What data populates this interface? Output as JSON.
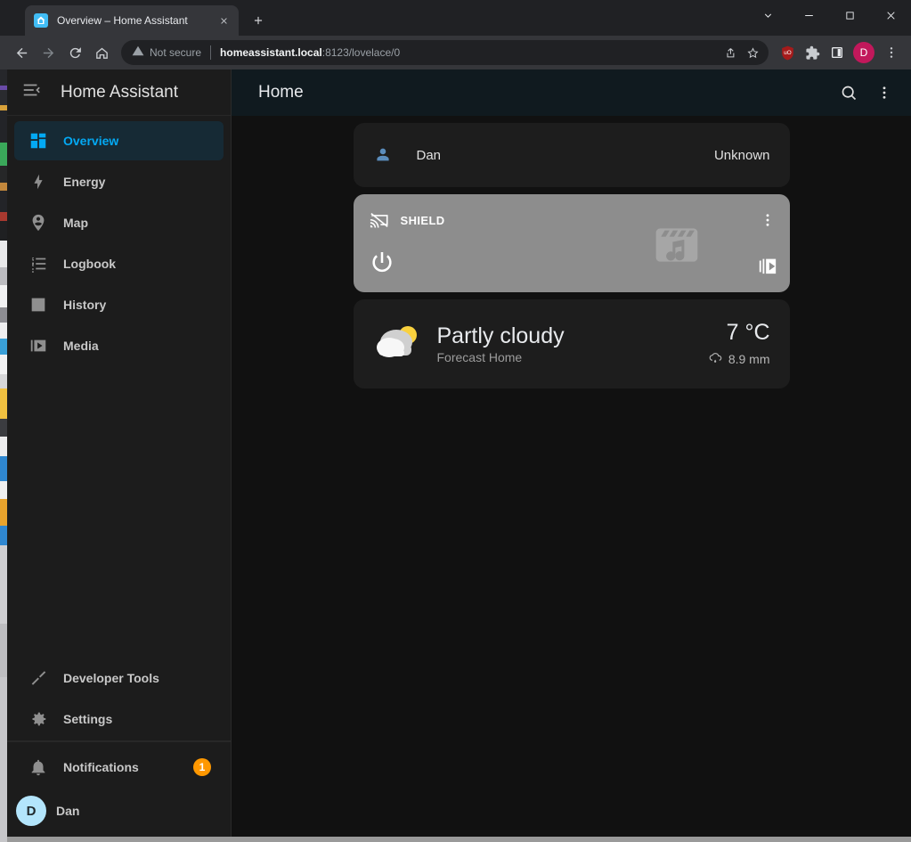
{
  "browser": {
    "tab": {
      "title": "Overview – Home Assistant",
      "favicon": "home-assistant-logo-icon",
      "close_icon": "close-icon"
    },
    "new_tab_label": "+",
    "window_controls": [
      "tab-search-chevron-icon",
      "minimize-icon",
      "maximize-icon",
      "close-icon"
    ],
    "toolbar": {
      "back_icon": "back-arrow-icon",
      "forward_icon": "forward-arrow-icon",
      "reload_icon": "reload-icon",
      "home_icon": "home-icon",
      "security_label": "Not secure",
      "security_icon": "warning-triangle-icon",
      "url_host": "homeassistant.local",
      "url_path": ":8123/lovelace/0",
      "share_icon": "share-icon",
      "bookmark_icon": "star-icon",
      "ublock_icon": "ublock-origin-shield-icon",
      "ublock_label": "uO",
      "extensions_icon": "puzzle-piece-icon",
      "sidepanel_icon": "side-panel-icon",
      "profile_initial": "D",
      "menu_icon": "kebab-menu-icon"
    }
  },
  "sidebar": {
    "menu_icon": "collapse-menu-icon",
    "title": "Home Assistant",
    "items": [
      {
        "label": "Overview",
        "icon": "view-dashboard-icon",
        "active": true
      },
      {
        "label": "Energy",
        "icon": "lightning-bolt-icon",
        "active": false
      },
      {
        "label": "Map",
        "icon": "map-marker-account-icon",
        "active": false
      },
      {
        "label": "Logbook",
        "icon": "format-list-icon",
        "active": false
      },
      {
        "label": "History",
        "icon": "chart-box-icon",
        "active": false
      },
      {
        "label": "Media",
        "icon": "play-box-multiple-icon",
        "active": false
      }
    ],
    "bottom_items": [
      {
        "label": "Developer Tools",
        "icon": "hammer-wrench-icon"
      },
      {
        "label": "Settings",
        "icon": "cog-icon"
      }
    ],
    "notifications": {
      "label": "Notifications",
      "icon": "bell-icon",
      "badge": "1",
      "badge_color": "#ff9800"
    },
    "user": {
      "label": "Dan",
      "initial": "D",
      "avatar_color": "#b3e5fc"
    }
  },
  "appbar": {
    "title": "Home",
    "search_icon": "search-icon",
    "overflow_icon": "kebab-menu-icon"
  },
  "cards": {
    "person": {
      "icon": "account-icon",
      "name": "Dan",
      "state": "Unknown"
    },
    "media_player": {
      "name": "SHIELD",
      "cast_icon": "cast-off-icon",
      "menu_icon": "kebab-menu-icon",
      "power_icon": "power-icon",
      "browse_icon": "play-box-multiple-icon",
      "watermark_icon": "movie-music-icon",
      "background_color": "#8d8d8d"
    },
    "weather": {
      "icon": "partly-cloudy-icon",
      "condition": "Partly cloudy",
      "entity": "Forecast Home",
      "temperature": "7 °C",
      "precipitation": "8.9 mm",
      "precipitation_icon": "weather-rainy-icon"
    }
  },
  "colors": {
    "accent": "#03a9f4",
    "badge": "#ff9800",
    "avatar": "#b3e5fc",
    "card_bg": "#1d1d1d",
    "page_bg": "#111111"
  }
}
